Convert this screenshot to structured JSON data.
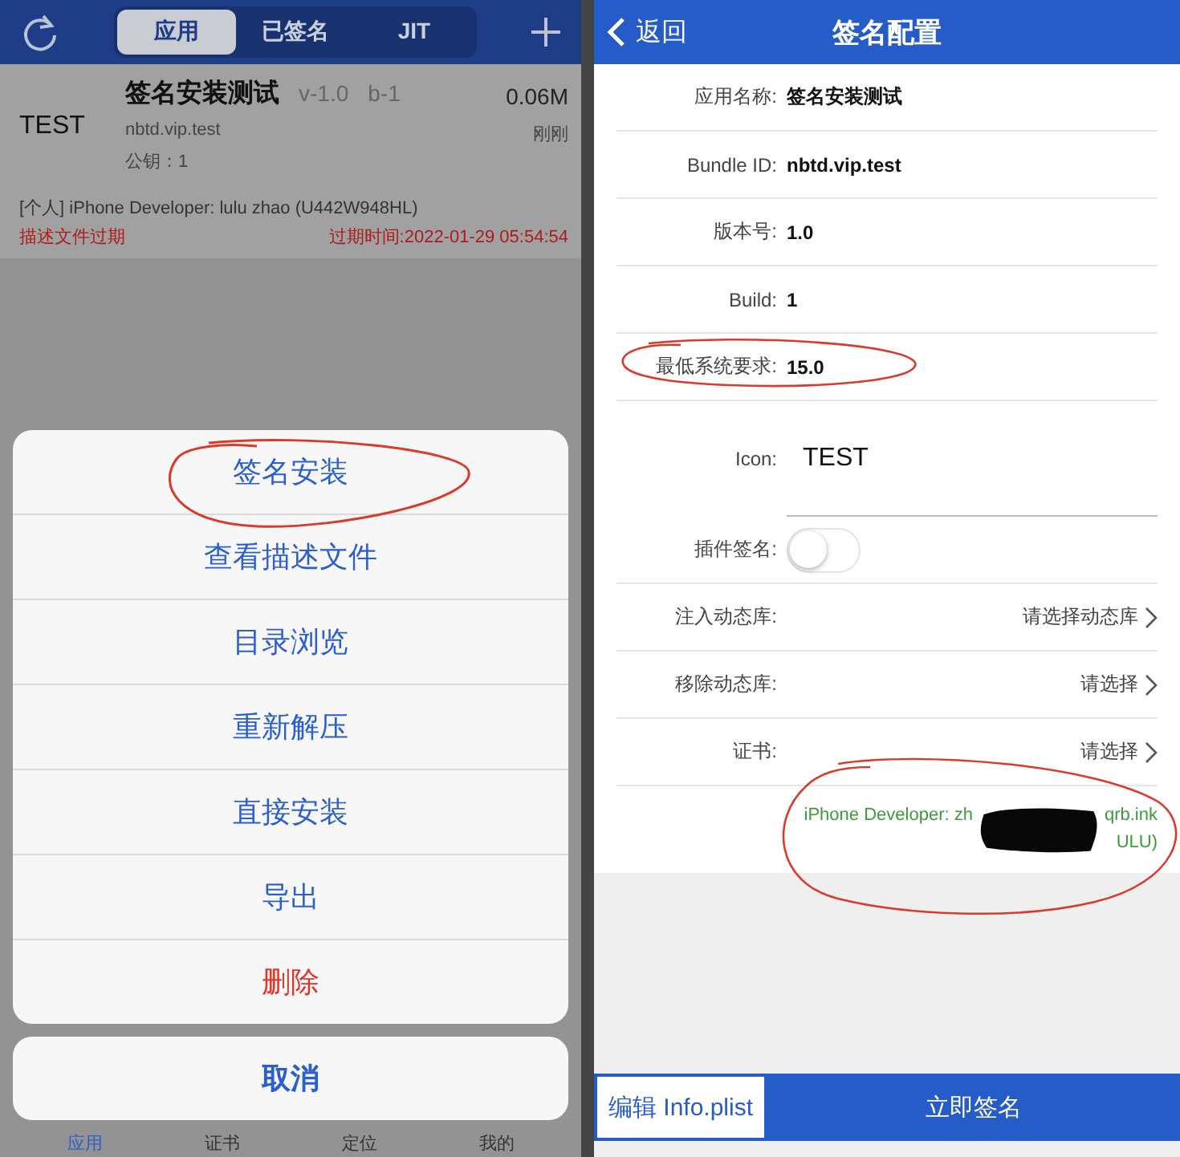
{
  "left_screen": {
    "segments": [
      {
        "label": "应用",
        "selected": true
      },
      {
        "label": "已签名",
        "selected": false
      },
      {
        "label": "JIT",
        "selected": false
      }
    ],
    "app_item": {
      "icon_text": "TEST",
      "name": "签名安装测试",
      "version": "v-1.0",
      "build": "b-1",
      "size": "0.06M",
      "bundle_id": "nbtd.vip.test",
      "time": "刚刚",
      "key": "公钥：1",
      "certificate": "[个人] iPhone Developer: lulu zhao (U442W948HL)",
      "status": "描述文件过期",
      "expiry": "过期时间:2022-01-29 05:54:54"
    },
    "action_sheet": {
      "actions": [
        {
          "label": "签名安装",
          "kind": "normal"
        },
        {
          "label": "查看描述文件",
          "kind": "normal"
        },
        {
          "label": "目录浏览",
          "kind": "normal"
        },
        {
          "label": "重新解压",
          "kind": "normal"
        },
        {
          "label": "直接安装",
          "kind": "normal"
        },
        {
          "label": "导出",
          "kind": "normal"
        },
        {
          "label": "删除",
          "kind": "destructive"
        }
      ],
      "cancel": "取消"
    },
    "tab_bar": [
      {
        "label": "应用",
        "selected": true
      },
      {
        "label": "证书",
        "selected": false
      },
      {
        "label": "定位",
        "selected": false
      },
      {
        "label": "我的",
        "selected": false
      }
    ]
  },
  "right_screen": {
    "back": "返回",
    "title": "签名配置",
    "fields": [
      {
        "kind": "text",
        "label": "应用名称:",
        "value": "签名安装测试"
      },
      {
        "kind": "text",
        "label": "Bundle ID:",
        "value": "nbtd.vip.test"
      },
      {
        "kind": "text",
        "label": "版本号:",
        "value": "1.0"
      },
      {
        "kind": "text",
        "label": "Build:",
        "value": "1"
      },
      {
        "kind": "text",
        "label": "最低系统要求:",
        "value": "15.0"
      },
      {
        "kind": "icon",
        "label": "Icon:",
        "value": "TEST"
      },
      {
        "kind": "toggle",
        "label": "插件签名:",
        "on": false
      },
      {
        "kind": "select",
        "label": "注入动态库:",
        "value": "请选择动态库"
      },
      {
        "kind": "select",
        "label": "移除动态库:",
        "value": "请选择"
      },
      {
        "kind": "select",
        "label": "证书:",
        "value": "请选择"
      }
    ],
    "certificate_lines": [
      [
        "iPhone Developer: zh",
        "qrb.ink"
      ],
      [
        "ULU)"
      ]
    ],
    "edit_button": "编辑 Info.plist",
    "sign_button": "立即签名"
  }
}
